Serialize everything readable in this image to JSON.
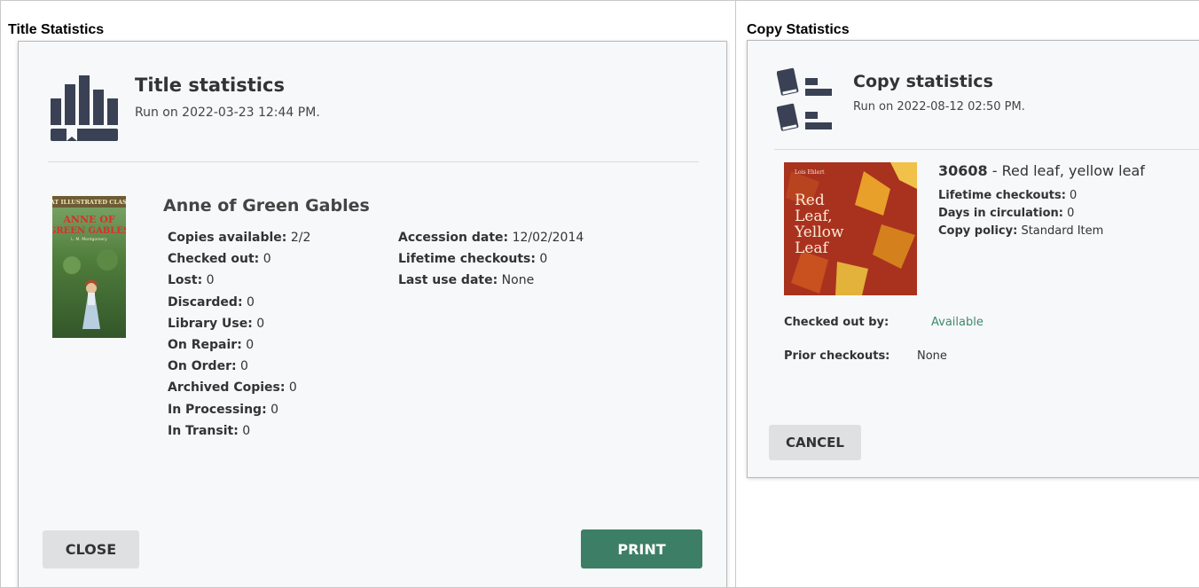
{
  "left": {
    "heading": "Title Statistics",
    "dialog": {
      "title": "Title statistics",
      "run_on": "Run on 2022-03-23 12:44 PM.",
      "icon": "title-statistics-icon",
      "book": {
        "title": "Anne of Green Gables",
        "cover": {
          "series": "GREAT ILLUSTRATED CLASSICS",
          "title_line1": "ANNE OF",
          "title_line2": "GREEN GABLES",
          "author": "L. M. Montgomery"
        }
      },
      "stats_col1": [
        {
          "label": "Copies available:",
          "value": "2/2"
        },
        {
          "label": "Checked out:",
          "value": "0"
        },
        {
          "label": "Lost:",
          "value": "0"
        },
        {
          "label": "Discarded:",
          "value": "0"
        },
        {
          "label": "Library Use:",
          "value": "0"
        },
        {
          "label": "On Repair:",
          "value": "0"
        },
        {
          "label": "On Order:",
          "value": "0"
        },
        {
          "label": "Archived Copies:",
          "value": "0"
        },
        {
          "label": "In Processing:",
          "value": "0"
        },
        {
          "label": "In Transit:",
          "value": "0"
        }
      ],
      "stats_col2": [
        {
          "label": "Accession date:",
          "value": "12/02/2014"
        },
        {
          "label": "Lifetime checkouts:",
          "value": "0"
        },
        {
          "label": "Last use date:",
          "value": "None"
        }
      ],
      "close_label": "CLOSE",
      "print_label": "PRINT",
      "colors": {
        "print_button": "#3d7f66",
        "close_button": "#dfe0e2"
      }
    }
  },
  "right": {
    "heading": "Copy Statistics",
    "dialog": {
      "title": "Copy statistics",
      "run_on": "Run on 2022-08-12 02:50 PM.",
      "icon": "copy-statistics-icon",
      "copy": {
        "barcode": "30608",
        "separator": " - ",
        "title": "Red leaf, yellow leaf",
        "cover": {
          "author": "Lois Ehlert",
          "line1": "Red",
          "line2": "Leaf,",
          "line3": "Yellow",
          "line4": "Leaf"
        }
      },
      "details": [
        {
          "label": "Lifetime checkouts:",
          "value": "0"
        },
        {
          "label": "Days in circulation:",
          "value": "0"
        },
        {
          "label": "Copy policy:",
          "value": "Standard Item"
        }
      ],
      "checked_out_by": {
        "label": "Checked out by:",
        "value": "Available"
      },
      "prior_checkouts": {
        "label": "Prior checkouts:",
        "value": "None"
      },
      "cancel_label": "CANCEL",
      "colors": {
        "available": "#3d8a6a"
      }
    }
  }
}
